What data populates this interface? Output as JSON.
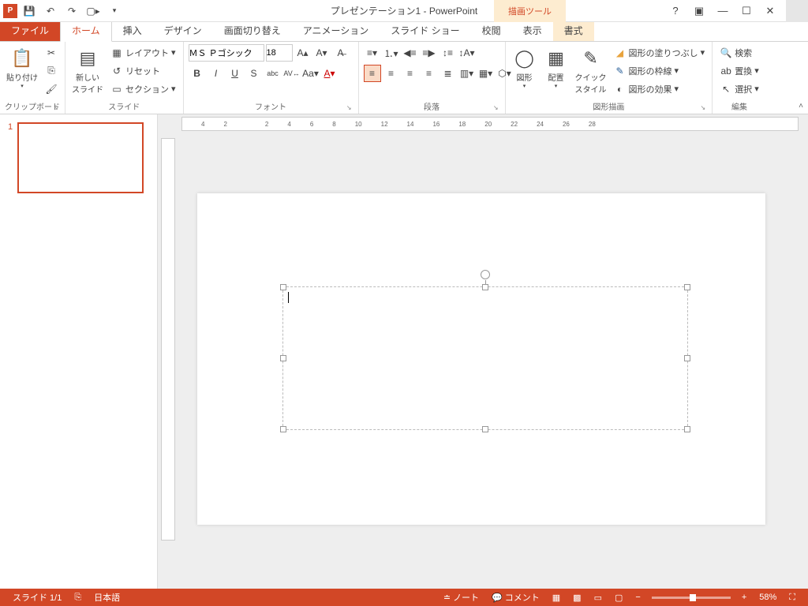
{
  "title": "プレゼンテーション1 - PowerPoint",
  "context_tool": "描画ツール",
  "tabs": {
    "file": "ファイル",
    "home": "ホーム",
    "insert": "挿入",
    "design": "デザイン",
    "trans": "画面切り替え",
    "anim": "アニメーション",
    "slideshow": "スライド ショー",
    "review": "校閲",
    "view": "表示",
    "format": "書式"
  },
  "groups": {
    "clipboard": "クリップボード",
    "slides": "スライド",
    "font": "フォント",
    "paragraph": "段落",
    "drawing": "図形描画",
    "editing": "編集"
  },
  "clipboard": {
    "paste": "貼り付け"
  },
  "slides": {
    "new": "新しい\nスライド",
    "layout": "レイアウト",
    "reset": "リセット",
    "section": "セクション"
  },
  "font": {
    "name": "ＭＳ Ｐゴシック",
    "size": "18"
  },
  "paragraph": {},
  "drawing": {
    "shape": "図形",
    "arrange": "配置",
    "quick": "クイック\nスタイル",
    "fill": "図形の塗りつぶし",
    "outline": "図形の枠線",
    "effects": "図形の効果"
  },
  "editing": {
    "find": "検索",
    "replace": "置換",
    "select": "選択"
  },
  "thumb": {
    "num": "1"
  },
  "ruler_marks": [
    "4",
    "2",
    "",
    "2",
    "4",
    "6",
    "8",
    "10",
    "12",
    "14",
    "16",
    "18",
    "20",
    "22",
    "24",
    "26",
    "28"
  ],
  "status": {
    "slide": "スライド 1/1",
    "lang": "日本語",
    "notes": "ノート",
    "comments": "コメント",
    "zoom": "58%"
  }
}
